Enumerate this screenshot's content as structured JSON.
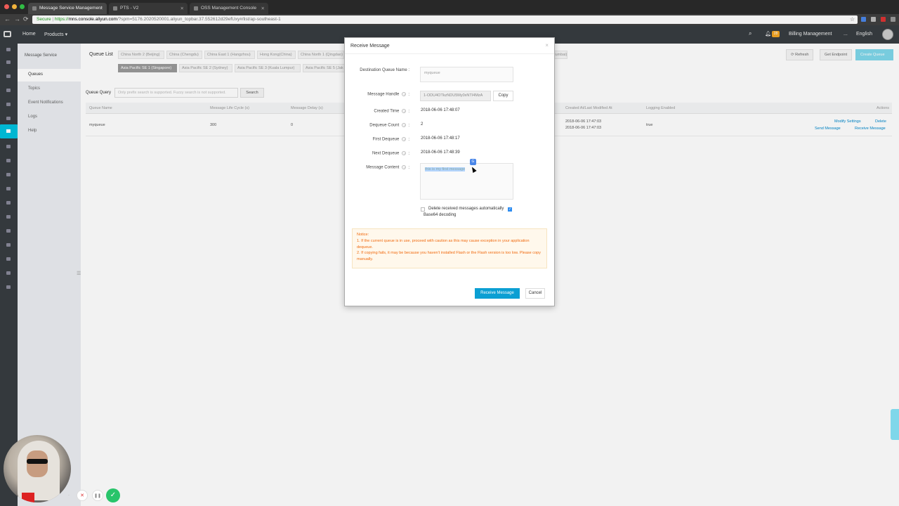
{
  "browser": {
    "tabs": [
      {
        "title": "Message Service Management"
      },
      {
        "title": "PTS - V2"
      },
      {
        "title": "OSS Management Console"
      }
    ],
    "url": {
      "secure_label": "Secure",
      "protocol": "https://",
      "host": "mns.console.aliyun.com",
      "path": "/?spm=5176.2020520001.aliyun_topbar.37.552612d29efUxy#/list/ap-southeast-1"
    }
  },
  "topnav": {
    "home": "Home",
    "products": "Products ▾",
    "notification_count": "28",
    "billing": "Billing Management",
    "more": "...",
    "language": "English"
  },
  "sidebar": {
    "title": "Message Service",
    "items": [
      {
        "label": "Queues"
      },
      {
        "label": "Topics"
      },
      {
        "label": "Event Notifications"
      },
      {
        "label": "Logs"
      },
      {
        "label": "Help"
      }
    ]
  },
  "main": {
    "queue_list_label": "Queue List",
    "regions_row1": [
      "China North 2 (Beijing)",
      "China (Chengdu)",
      "China East 1 (Hangzhou)",
      "Hong Kong(China)",
      "China North 1 (Qingdao)"
    ],
    "regions_row1_right": "Mumbai)",
    "regions_row2": [
      "Asia Pacific SE 1 (Singapore)",
      "Asia Pacific SE 2 (Sydney)",
      "Asia Pacific SE 3 (Kuala Lumpur)",
      "Asia Pacific SE 5 (Jak"
    ],
    "buttons": {
      "refresh": "⟳ Refresh",
      "get_endpoint": "Get Endpoint",
      "create_queue": "Create Queue"
    },
    "query": {
      "label": "Queue Query",
      "placeholder": "Only prefix search is supported. Fuzzy search is not supported.",
      "search_button": "Search"
    },
    "table": {
      "headers": {
        "queue_name": "Queue Name",
        "life_cycle": "Message Life Cycle (s)",
        "delay": "Message Delay (s)",
        "created": "Created At/Last Modified At",
        "logging": "Logging Enabled",
        "actions": "Actions"
      },
      "rows": [
        {
          "queue_name": "myqueue",
          "life_cycle": "300",
          "delay": "0",
          "created_at": "2018-06-06 17:47:03",
          "modified_at": "2018-06-06 17:47:03",
          "logging": "true",
          "actions": {
            "modify": "Modify Settings",
            "delete": "Delete",
            "send": "Send Message",
            "receive": "Receive Message"
          }
        }
      ]
    }
  },
  "modal": {
    "title": "Receive Message",
    "close": "×",
    "fields": {
      "queue_name_label": "Destination Queue Name :",
      "queue_name_value": "myqueue",
      "handle_label": "Message Handle",
      "handle_value": "1-ODU4OTkzNDU5My0xNTI4MzA",
      "copy": "Copy",
      "created_label": "Created Time",
      "created_value": "2018-06-06 17:48:07",
      "dequeue_count_label": "Dequeue Count",
      "dequeue_count_value": "2",
      "first_dequeue_label": "First Dequeue",
      "first_dequeue_value": "2018-06-06 17:48:17",
      "next_dequeue_label": "Next Dequeue",
      "next_dequeue_value": "2018-06-06 17:48:39",
      "content_label": "Message Content",
      "content_value": "this is my first message"
    },
    "colon": ":",
    "help_mark": "?",
    "check_mark": "✓",
    "options": {
      "delete_auto": "Delete received messages automatically",
      "base64": "Base64 decoding"
    },
    "notice": {
      "title": "Notice:",
      "line1": "1. If the current queue is in use, proceed with caution as this may cause exception in your application dequeue.",
      "line2": "2. If copying fails, it may be because you haven't installed Flash or the Flash version is too low. Please copy manually."
    },
    "receive_button": "Receive Message",
    "cancel_button": "Cancel"
  },
  "controls": {
    "close": "✕",
    "pause": "❚❚",
    "done": "✓",
    "dot": "·"
  },
  "colors": {
    "accent": "#00c1de",
    "primary_button": "#0b9fd3",
    "notice_text": "#f06a0f",
    "topbar": "#373d41"
  }
}
